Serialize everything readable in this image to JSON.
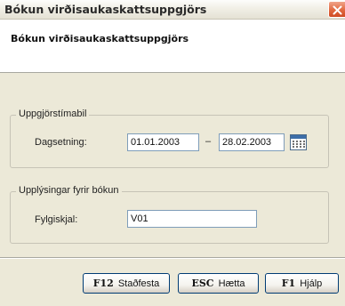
{
  "window": {
    "title": "Bókun virðisaukaskattsuppgjörs"
  },
  "header": {
    "title": "Bókun virðisaukaskattsuppgjörs"
  },
  "period_group": {
    "legend": "Uppgjörstímabil",
    "date_label": "Dagsetning:",
    "date_from": "01.01.2003",
    "date_separator": "–",
    "date_to": "28.02.2003"
  },
  "posting_group": {
    "legend": "Upplýsingar fyrir bókun",
    "document_label": "Fylgiskjal:",
    "document_value": "V01"
  },
  "buttons": [
    {
      "key": "F12",
      "label": "Staðfesta"
    },
    {
      "key": "ESC",
      "label": "Hætta"
    },
    {
      "key": "F1",
      "label": "Hjálp"
    }
  ]
}
